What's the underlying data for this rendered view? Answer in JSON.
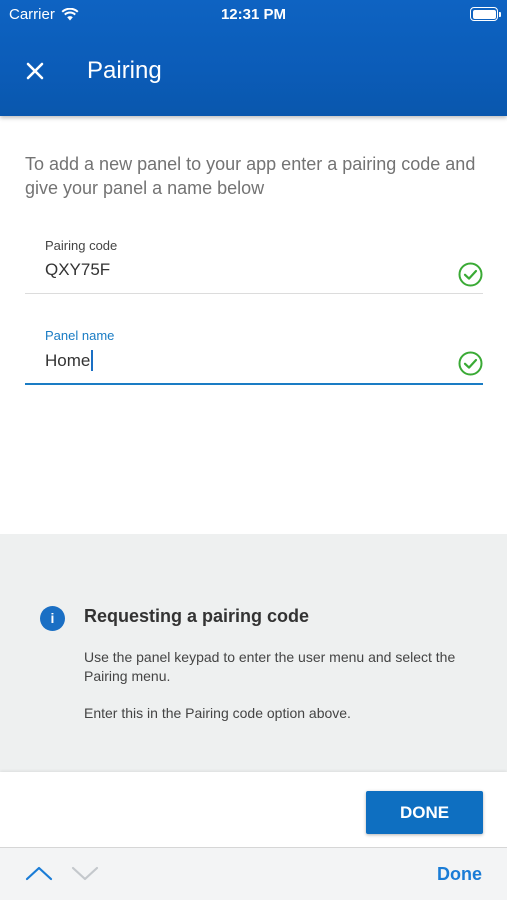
{
  "status_bar": {
    "carrier": "Carrier",
    "time": "12:31 PM"
  },
  "header": {
    "title": "Pairing",
    "close_icon": "close-icon"
  },
  "intro": "To add a new panel to your app enter a pairing code and give your panel a name below",
  "fields": {
    "pairing_code": {
      "label": "Pairing code",
      "value": "QXY75F",
      "status_icon": "check-circle-icon"
    },
    "panel_name": {
      "label": "Panel name",
      "value": "Home",
      "status_icon": "check-circle-icon"
    }
  },
  "info": {
    "icon": "info-icon",
    "icon_glyph": "i",
    "title": "Requesting a pairing code",
    "paragraph1": "Use the panel keypad to enter the user menu and select the Pairing menu.",
    "paragraph2": "Enter this in the Pairing code option above."
  },
  "actions": {
    "done_label": "DONE"
  },
  "keyboard_bar": {
    "done_label": "Done",
    "prev_icon": "chevron-up-icon",
    "next_icon": "chevron-down-icon"
  },
  "colors": {
    "header": "#0b5cb8",
    "accent": "#1a7cc4",
    "success": "#3aaa35",
    "info_bg": "#eef0f0"
  }
}
